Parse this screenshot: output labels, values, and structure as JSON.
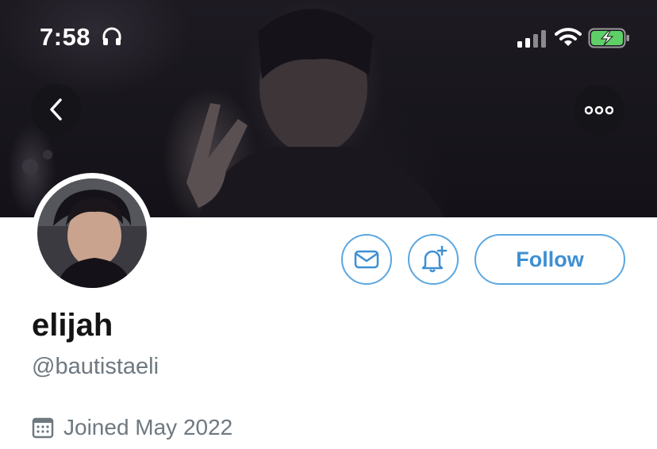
{
  "status_bar": {
    "time": "7:58",
    "icons": [
      "headphones-icon",
      "cellular-signal-icon",
      "wifi-icon",
      "battery-charging-icon"
    ],
    "battery_color": "#5fd068"
  },
  "header": {
    "back_icon": "chevron-left-icon",
    "more_icon": "more-horizontal-icon"
  },
  "profile": {
    "display_name": "elijah",
    "handle": "@bautistaeli",
    "joined": "Joined May 2022",
    "joined_icon": "calendar-icon"
  },
  "actions": {
    "message_icon": "envelope-icon",
    "notify_icon": "bell-plus-icon",
    "follow_label": "Follow",
    "accent_color": "#3e8fd3"
  }
}
